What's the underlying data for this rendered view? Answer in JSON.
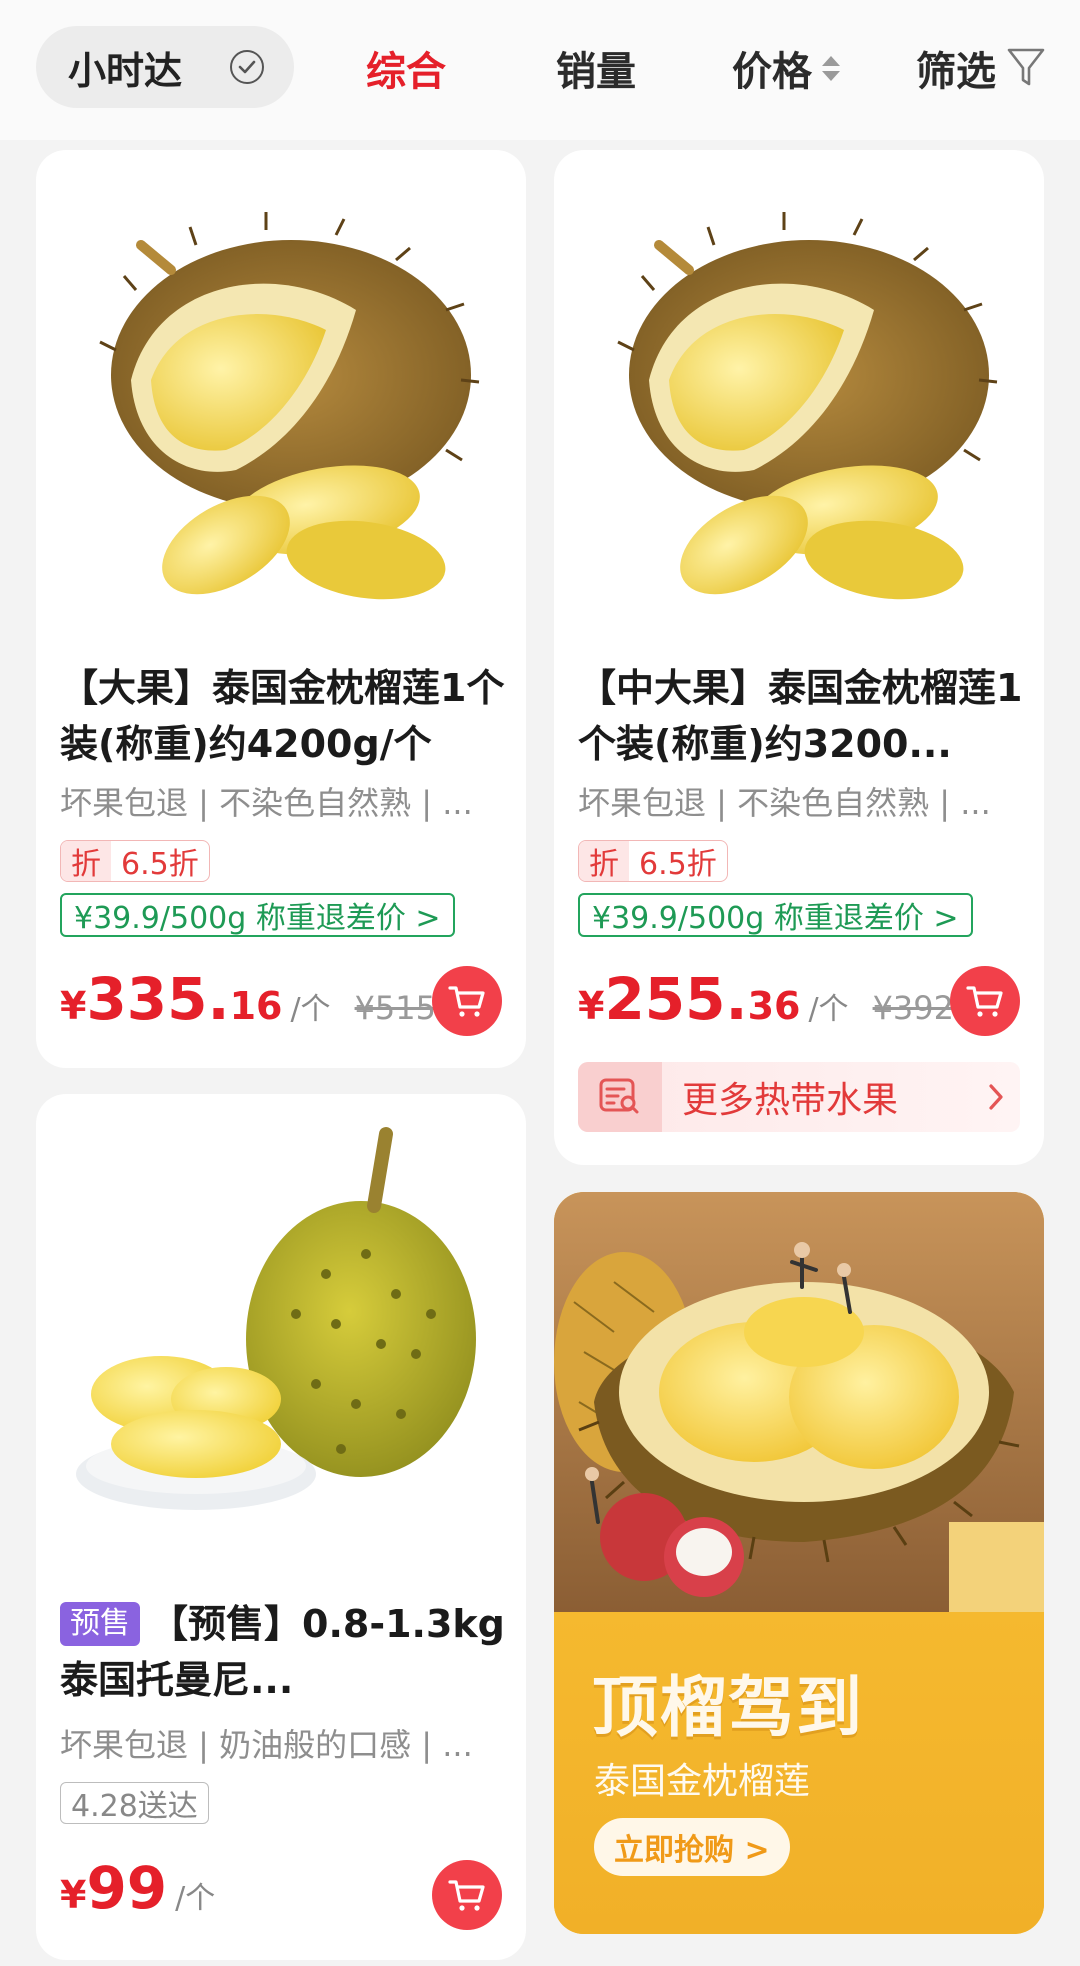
{
  "sortbar": {
    "chip_label": "小时达",
    "tabs": [
      "综合",
      "销量",
      "价格",
      "筛选"
    ]
  },
  "products": [
    {
      "title": "【大果】泰国金枕榴莲1个装(称重)约4200g/个",
      "features": "坏果包退 | 不染色自然熟 | ...",
      "discount_tag": "折",
      "discount_rate": "6.5折",
      "unit_price_tag": "¥39.9/500g 称重退差价 >",
      "price_symbol": "¥",
      "price_int": "335.",
      "price_dec": "16",
      "price_unit": "/个",
      "orig_price": "¥515.7"
    },
    {
      "title": "【中大果】泰国金枕榴莲1个装(称重)约3200...",
      "features": "坏果包退 | 不染色自然熟 | ...",
      "discount_tag": "折",
      "discount_rate": "6.5折",
      "unit_price_tag": "¥39.9/500g 称重退差价 >",
      "price_symbol": "¥",
      "price_int": "255.",
      "price_dec": "36",
      "price_unit": "/个",
      "orig_price": "¥392.9",
      "more_label": "更多热带水果"
    },
    {
      "badge": "预售",
      "title": "【预售】0.8-1.3kg泰国托曼尼...",
      "features": "坏果包退 | 奶油般的口感 | ...",
      "delivery": "4.28送达",
      "price_symbol": "¥",
      "price_int": "99",
      "price_unit": "/个"
    }
  ],
  "promo": {
    "title": "顶榴驾到",
    "subtitle": "泰国金枕榴莲",
    "button": "立即抢购 >"
  }
}
